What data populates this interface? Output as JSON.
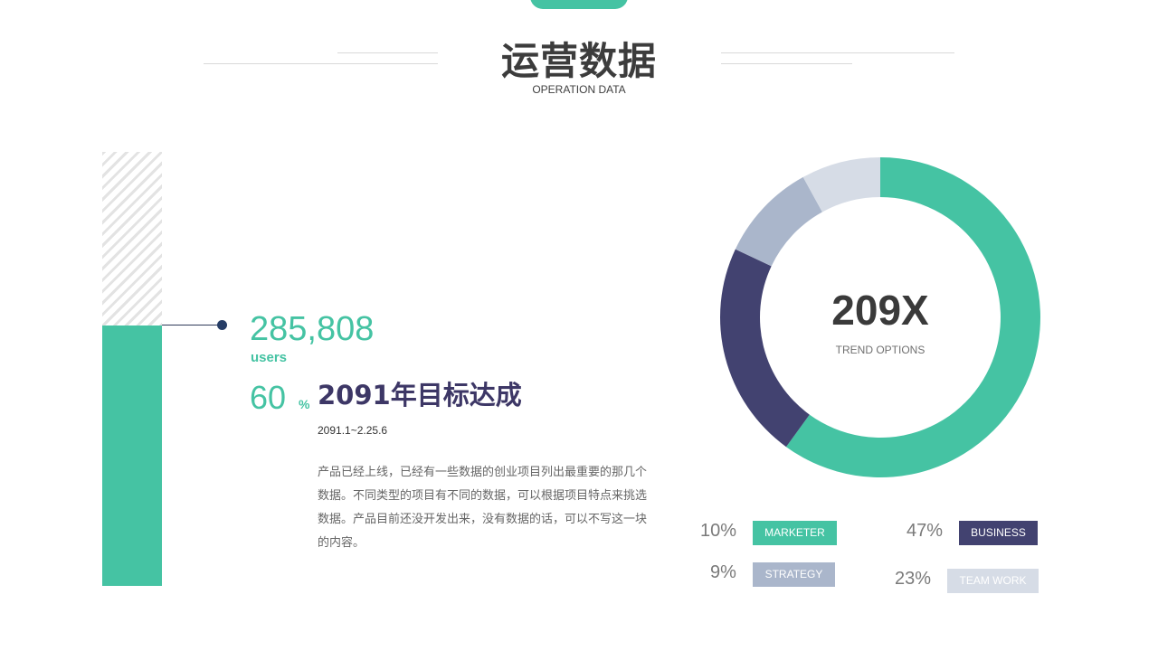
{
  "header": {
    "title": "运营数据",
    "subtitle": "OPERATION DATA"
  },
  "progress": {
    "value": "285,808",
    "unit_label": "users",
    "percent": "60",
    "percent_sign": "%",
    "fill_fraction": 0.6
  },
  "goal": {
    "title": "2091年目标达成",
    "date": "2091.1~2.25.6",
    "description": "产品已经上线，已经有一些数据的创业项目列出最重要的那几个数据。不同类型的项目有不同的数据，可以根据项目特点来挑选数据。产品目前还没开发出来，没有数据的话，可以不写这一块的内容。"
  },
  "donut": {
    "center_value": "209X",
    "center_label": "TREND OPTIONS"
  },
  "chart_data": {
    "type": "pie",
    "style": "donut",
    "center_value": "209X",
    "center_label": "TREND OPTIONS",
    "legend_placement": "bottom",
    "series": [
      {
        "name": "MARKETER",
        "label": "10%",
        "value": 10,
        "color": "#45c3a3"
      },
      {
        "name": "BUSINESS",
        "label": "47%",
        "value": 47,
        "color": "#424270"
      },
      {
        "name": "STRATEGY",
        "label": "9%",
        "value": 9,
        "color": "#aab6cb"
      },
      {
        "name": "TEAM WORK",
        "label": "23%",
        "value": 23,
        "color": "#d6dce6"
      }
    ],
    "drawn_slices": [
      {
        "name": "MARKETER",
        "value": 60,
        "color": "#45c3a3"
      },
      {
        "name": "BUSINESS",
        "value": 22,
        "color": "#424270"
      },
      {
        "name": "STRATEGY",
        "value": 10,
        "color": "#aab6cb"
      },
      {
        "name": "TEAM WORK",
        "value": 8,
        "color": "#d6dce6"
      }
    ]
  }
}
